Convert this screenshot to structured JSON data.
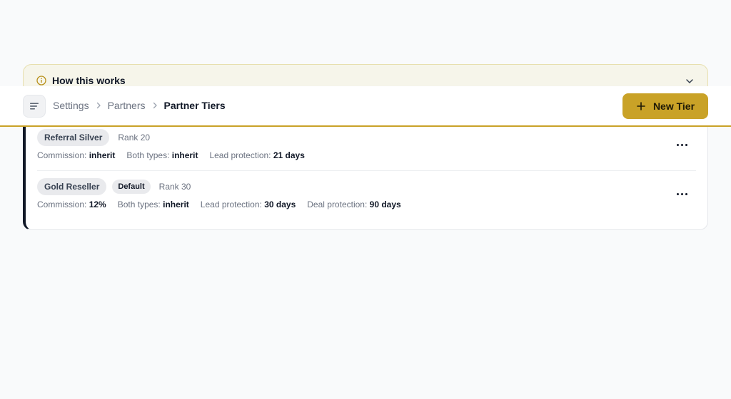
{
  "callout": {
    "title": "How this works",
    "icon": "info-icon",
    "expand_icon": "chevron-down-icon",
    "accent_color": "#c9a227"
  },
  "header": {
    "breadcrumbs": [
      "Settings",
      "Partners",
      "Partner Tiers"
    ],
    "new_button_label": "New Tier",
    "menu_icon": "menu-icon",
    "accent_color": "#c9a227"
  },
  "tiers": [
    {
      "name": "Referral Silver",
      "rank": "Rank 20",
      "details": [
        {
          "label": "Commission:",
          "value": "inherit"
        },
        {
          "label": "Both types:",
          "value": "inherit"
        },
        {
          "label": "Lead protection:",
          "value": "21 days"
        }
      ]
    },
    {
      "name": "Gold Reseller",
      "badge": "Default",
      "rank": "Rank 30",
      "details": [
        {
          "label": "Commission:",
          "value": "12%"
        },
        {
          "label": "Both types:",
          "value": "inherit"
        },
        {
          "label": "Lead protection:",
          "value": "30 days"
        },
        {
          "label": "Deal protection:",
          "value": "90 days"
        }
      ]
    }
  ]
}
